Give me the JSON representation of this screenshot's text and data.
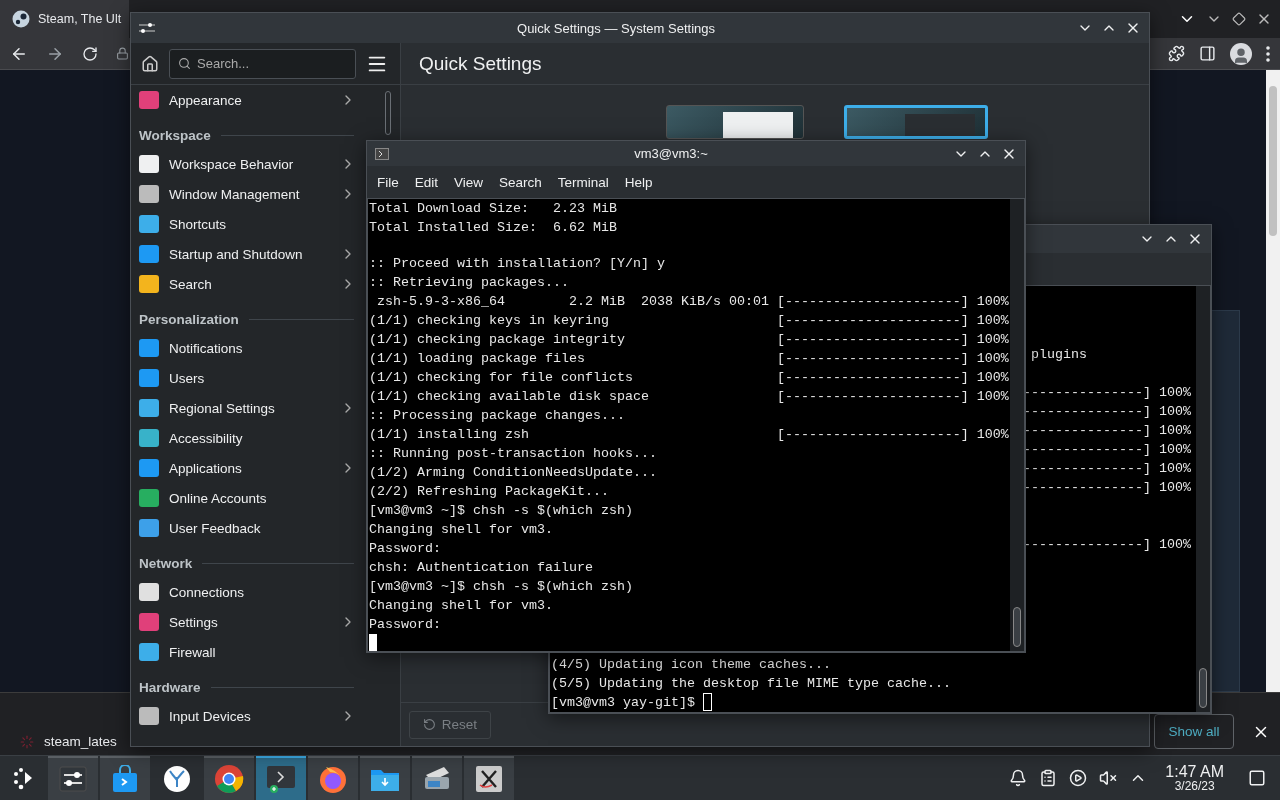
{
  "browser": {
    "tab_title": "Steam, The Ult",
    "download": {
      "file": "steam_lates"
    },
    "show_all": "Show all"
  },
  "settings": {
    "title": "Quick Settings — System Settings",
    "search": {
      "placeholder": "Search..."
    },
    "page_title": "Quick Settings",
    "reset": "Reset",
    "sidebar": [
      {
        "kind": "item",
        "label": "Appearance",
        "chevron": true
      },
      {
        "kind": "header",
        "label": "Workspace"
      },
      {
        "kind": "item",
        "label": "Workspace Behavior",
        "chevron": true
      },
      {
        "kind": "item",
        "label": "Window Management",
        "chevron": true
      },
      {
        "kind": "item",
        "label": "Shortcuts",
        "chevron": false
      },
      {
        "kind": "item",
        "label": "Startup and Shutdown",
        "chevron": true
      },
      {
        "kind": "item",
        "label": "Search",
        "chevron": true
      },
      {
        "kind": "header",
        "label": "Personalization"
      },
      {
        "kind": "item",
        "label": "Notifications",
        "chevron": false
      },
      {
        "kind": "item",
        "label": "Users",
        "chevron": false
      },
      {
        "kind": "item",
        "label": "Regional Settings",
        "chevron": true
      },
      {
        "kind": "item",
        "label": "Accessibility",
        "chevron": false
      },
      {
        "kind": "item",
        "label": "Applications",
        "chevron": true
      },
      {
        "kind": "item",
        "label": "Online Accounts",
        "chevron": false
      },
      {
        "kind": "item",
        "label": "User Feedback",
        "chevron": false
      },
      {
        "kind": "header",
        "label": "Network"
      },
      {
        "kind": "item",
        "label": "Connections",
        "chevron": false
      },
      {
        "kind": "item",
        "label": "Settings",
        "chevron": true
      },
      {
        "kind": "item",
        "label": "Firewall",
        "chevron": false
      },
      {
        "kind": "header",
        "label": "Hardware"
      },
      {
        "kind": "item",
        "label": "Input Devices",
        "chevron": true
      }
    ],
    "themes": [
      {
        "kind": "light",
        "selected": false
      },
      {
        "kind": "dark",
        "selected": true
      }
    ]
  },
  "terminal_back": {
    "groups": [
      [
        " plugins"
      ],
      [
        "---------------] 100%",
        "---------------] 100%",
        "---------------] 100%",
        "---------------] 100%",
        "---------------] 100%",
        "---------------] 100%"
      ],
      [
        "---------------] 100%"
      ]
    ],
    "lines": [
      "(4/5) Updating icon theme caches...",
      "(5/5) Updating the desktop file MIME type cache...",
      "[vm3@vm3 yay-git]$ "
    ]
  },
  "terminal": {
    "title": "vm3@vm3:~",
    "menu": [
      "File",
      "Edit",
      "View",
      "Search",
      "Terminal",
      "Help"
    ],
    "lines": [
      {
        "kind": "text",
        "text": "Total Download Size:   2.23 MiB"
      },
      {
        "kind": "text",
        "text": "Total Installed Size:  6.62 MiB"
      },
      {
        "kind": "blank"
      },
      {
        "kind": "text",
        "text": ":: Proceed with installation? [Y/n] y"
      },
      {
        "kind": "text",
        "text": ":: Retrieving packages..."
      },
      {
        "kind": "progress",
        "text": " zsh-5.9-3-x86_64        2.2 MiB  2038 KiB/s 00:01",
        "bar": "[----------------------] 100%"
      },
      {
        "kind": "progress",
        "text": "(1/1) checking keys in keyring",
        "bar": "[----------------------] 100%"
      },
      {
        "kind": "progress",
        "text": "(1/1) checking package integrity",
        "bar": "[----------------------] 100%"
      },
      {
        "kind": "progress",
        "text": "(1/1) loading package files",
        "bar": "[----------------------] 100%"
      },
      {
        "kind": "progress",
        "text": "(1/1) checking for file conflicts",
        "bar": "[----------------------] 100%"
      },
      {
        "kind": "progress",
        "text": "(1/1) checking available disk space",
        "bar": "[----------------------] 100%"
      },
      {
        "kind": "text",
        "text": ":: Processing package changes..."
      },
      {
        "kind": "progress",
        "text": "(1/1) installing zsh",
        "bar": "[----------------------] 100%"
      },
      {
        "kind": "text",
        "text": ":: Running post-transaction hooks..."
      },
      {
        "kind": "text",
        "text": "(1/2) Arming ConditionNeedsUpdate..."
      },
      {
        "kind": "text",
        "text": "(2/2) Refreshing PackageKit..."
      },
      {
        "kind": "text",
        "text": "[vm3@vm3 ~]$ chsh -s $(which zsh)"
      },
      {
        "kind": "text",
        "text": "Changing shell for vm3."
      },
      {
        "kind": "text",
        "text": "Password:"
      },
      {
        "kind": "text",
        "text": "chsh: Authentication failure"
      },
      {
        "kind": "text",
        "text": "[vm3@vm3 ~]$ chsh -s $(which zsh)"
      },
      {
        "kind": "text",
        "text": "Changing shell for vm3."
      },
      {
        "kind": "text",
        "text": "Password:"
      }
    ]
  },
  "taskbar": {
    "tasks": [
      {
        "kind": "settings",
        "running": true,
        "selected": false
      },
      {
        "kind": "store",
        "running": true,
        "selected": false
      },
      {
        "kind": "app",
        "running": false,
        "selected": false
      },
      {
        "kind": "browser",
        "running": true,
        "selected": false
      },
      {
        "kind": "terminal",
        "running": true,
        "selected": true
      },
      {
        "kind": "web",
        "running": true,
        "selected": false
      },
      {
        "kind": "folder",
        "running": true,
        "selected": false
      },
      {
        "kind": "scanner",
        "running": true,
        "selected": false
      },
      {
        "kind": "x",
        "running": true,
        "selected": false
      }
    ],
    "clock": {
      "time": "1:47 AM",
      "date": "3/26/23"
    }
  }
}
